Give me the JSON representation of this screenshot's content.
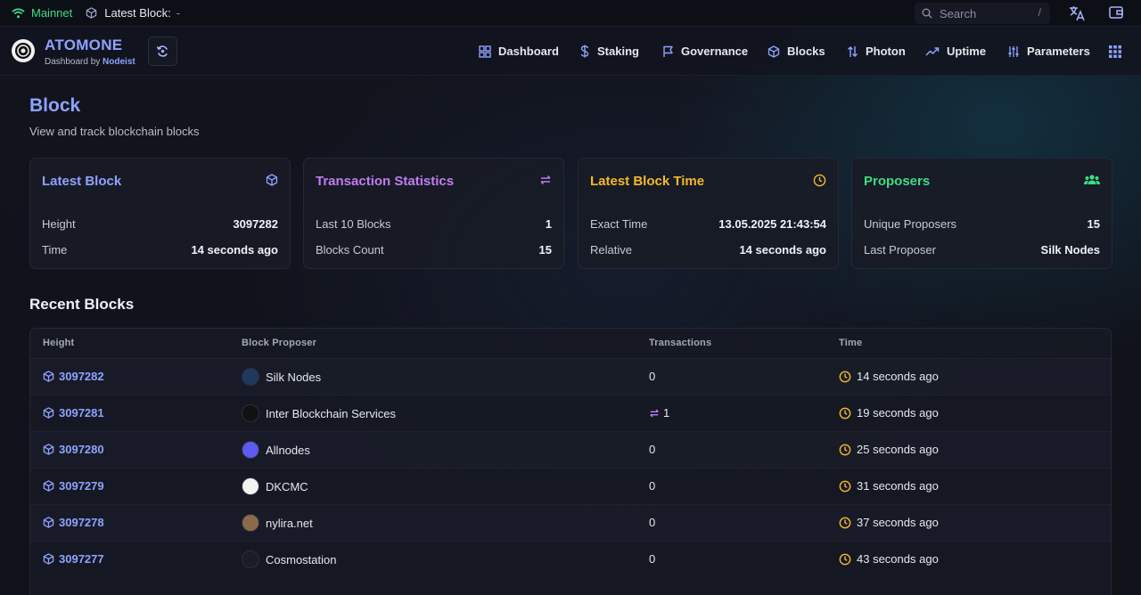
{
  "topbar": {
    "network": "Mainnet",
    "latest_block_label": "Latest Block:",
    "latest_block_value": "-",
    "search_placeholder": "Search",
    "search_shortcut": "/"
  },
  "header": {
    "brand": "ATOMONE",
    "subtitle_prefix": "Dashboard by ",
    "subtitle_author": "Nodeist",
    "nav": [
      "Dashboard",
      "Staking",
      "Governance",
      "Blocks",
      "Photon",
      "Uptime",
      "Parameters"
    ]
  },
  "page": {
    "title": "Block",
    "subtitle": "View and track blockchain blocks"
  },
  "cards": [
    {
      "title": "Latest Block",
      "color": "#8fa2ff",
      "icon": "cube-icon",
      "rows": [
        {
          "label": "Height",
          "value": "3097282"
        },
        {
          "label": "Time",
          "value": "14 seconds ago"
        }
      ]
    },
    {
      "title": "Transaction Statistics",
      "color": "#c07cf0",
      "icon": "arrows-exchange-icon",
      "rows": [
        {
          "label": "Last 10 Blocks",
          "value": "1"
        },
        {
          "label": "Blocks Count",
          "value": "15"
        }
      ]
    },
    {
      "title": "Latest Block Time",
      "color": "#f5b82e",
      "icon": "clock-icon",
      "rows": [
        {
          "label": "Exact Time",
          "value": "13.05.2025 21:43:54"
        },
        {
          "label": "Relative",
          "value": "14 seconds ago"
        }
      ]
    },
    {
      "title": "Proposers",
      "color": "#3ddc84",
      "icon": "users-icon",
      "rows": [
        {
          "label": "Unique Proposers",
          "value": "15"
        },
        {
          "label": "Last Proposer",
          "value": "Silk Nodes"
        }
      ]
    }
  ],
  "recent": {
    "title": "Recent Blocks",
    "headers": [
      "Height",
      "Block Proposer",
      "Transactions",
      "Time"
    ],
    "rows": [
      {
        "height": "3097282",
        "proposer": "Silk Nodes",
        "tx": "0",
        "time": "14 seconds ago",
        "avatar_bg": "#1d3a5c",
        "avatar_fg": "#7fd3ff",
        "has_tx_icon": false
      },
      {
        "height": "3097281",
        "proposer": "Inter Blockchain Services",
        "tx": "1",
        "time": "19 seconds ago",
        "avatar_bg": "#111111",
        "avatar_fg": "#ffffff",
        "has_tx_icon": true
      },
      {
        "height": "3097280",
        "proposer": "Allnodes",
        "tx": "0",
        "time": "25 seconds ago",
        "avatar_bg": "#5b5bf0",
        "avatar_fg": "#ffffff",
        "has_tx_icon": false
      },
      {
        "height": "3097279",
        "proposer": "DKCMC",
        "tx": "0",
        "time": "31 seconds ago",
        "avatar_bg": "#f2f2f2",
        "avatar_fg": "#222222",
        "has_tx_icon": false
      },
      {
        "height": "3097278",
        "proposer": "nylira.net",
        "tx": "0",
        "time": "37 seconds ago",
        "avatar_bg": "#8a6a4a",
        "avatar_fg": "#ffffff",
        "has_tx_icon": false
      },
      {
        "height": "3097277",
        "proposer": "Cosmostation",
        "tx": "0",
        "time": "43 seconds ago",
        "avatar_bg": "#1a1c2a",
        "avatar_fg": "#8fa2ff",
        "has_tx_icon": false
      }
    ]
  }
}
